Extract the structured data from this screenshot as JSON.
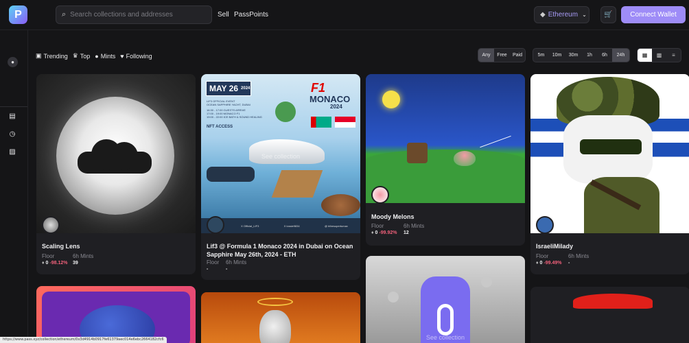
{
  "header": {
    "search_placeholder": "Search collections and addresses",
    "nav": [
      "Sell",
      "PassPoints"
    ],
    "chain": "Ethereum",
    "connect_label": "Connect Wallet"
  },
  "filters": {
    "tabs": [
      "Trending",
      "Top",
      "Mints",
      "Following"
    ],
    "active_tab": "Mints",
    "price": [
      "Any",
      "Free",
      "Paid"
    ],
    "price_active": "Any",
    "time": [
      "5m",
      "10m",
      "30m",
      "1h",
      "6h",
      "24h"
    ],
    "time_active": "24h"
  },
  "labels": {
    "floor": "Floor",
    "mints": "6h Mints",
    "see_collection": "See collection"
  },
  "collections": [
    {
      "name": "Scaling Lens",
      "floor": "0",
      "change": "-98.12%",
      "mints": "39"
    },
    {
      "name": "Lif3 @ Formula 1 Monaco 2024 in Dubai on Ocean Sapphire May 26th, 2024 - ETH",
      "floor": "-",
      "change": "",
      "mints": "-"
    },
    {
      "name": "Moody Melons",
      "floor": "0",
      "change": "-99.92%",
      "mints": "12"
    },
    {
      "name": "IsraeliMilady",
      "floor": "0",
      "change": "-99.49%",
      "mints": "-"
    }
  ],
  "poster": {
    "date": "MAY 26",
    "year": "2024",
    "event": "LIF3 OFFICIAL EVENT",
    "venue": "OCEAN SAPPHIRE YACHT, DUBAI",
    "schedule": [
      "16:30 - 17:00 GUESTS ARRIVE",
      "17:00 - 19:00 MONACO F1",
      "19:00 - 22:00 ICE BATH & SOUND HEALING"
    ],
    "access": "NFT ACCESS",
    "brand": "MONACO",
    "brand_year": "2024",
    "f1": "F1",
    "footer": [
      "X Official_LIF3",
      "X lossie9834",
      "@ tribesupertumax"
    ]
  },
  "status_url": "https://www.pass.xyz/collection/ethereum/0x3d4914b0917fe61379aec014e6ebc2664182cfc6",
  "colors": {
    "accent": "#9e8cf7",
    "negative": "#f0607a"
  }
}
